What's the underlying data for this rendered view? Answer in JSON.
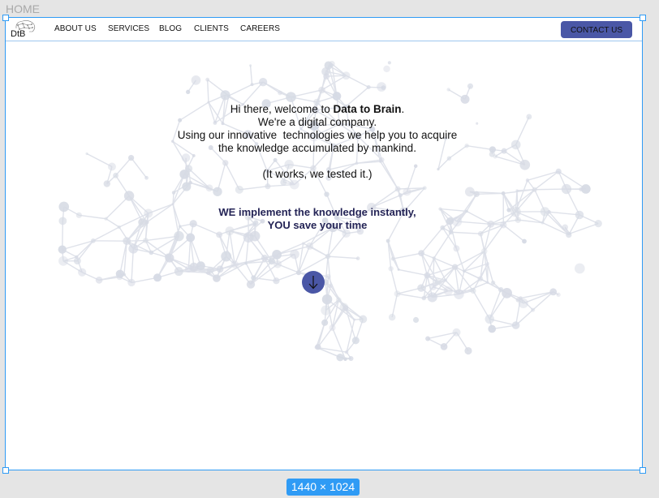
{
  "frame": {
    "name": "HOME",
    "size_label": "1440 × 1024"
  },
  "navbar": {
    "logo_text": "DtB",
    "items": [
      "ABOUT US",
      "SERVICES",
      "BLOG",
      "CLIENTS",
      "CAREERS"
    ],
    "contact_label": "CONTACT US"
  },
  "hero": {
    "intro_prefix": "Hi there, welcome to ",
    "brand_name": "Data to Brain",
    "intro_suffix": ".",
    "line2": "We're a digital company.",
    "line3": "Using our innovative  technologies we help you to acquire",
    "line4": "the knowledge accumulated by mankind.",
    "line5": "(It works, we tested it.)",
    "tagline_line1": "WE implement the knowledge instantly,",
    "tagline_line2": "YOU save your time"
  },
  "colors": {
    "accent": "#4a57a6",
    "tagline": "#242456",
    "selection": "#2f9bf5"
  },
  "icons": {
    "scroll": "arrow-down-icon",
    "logo": "brain-network-icon"
  }
}
